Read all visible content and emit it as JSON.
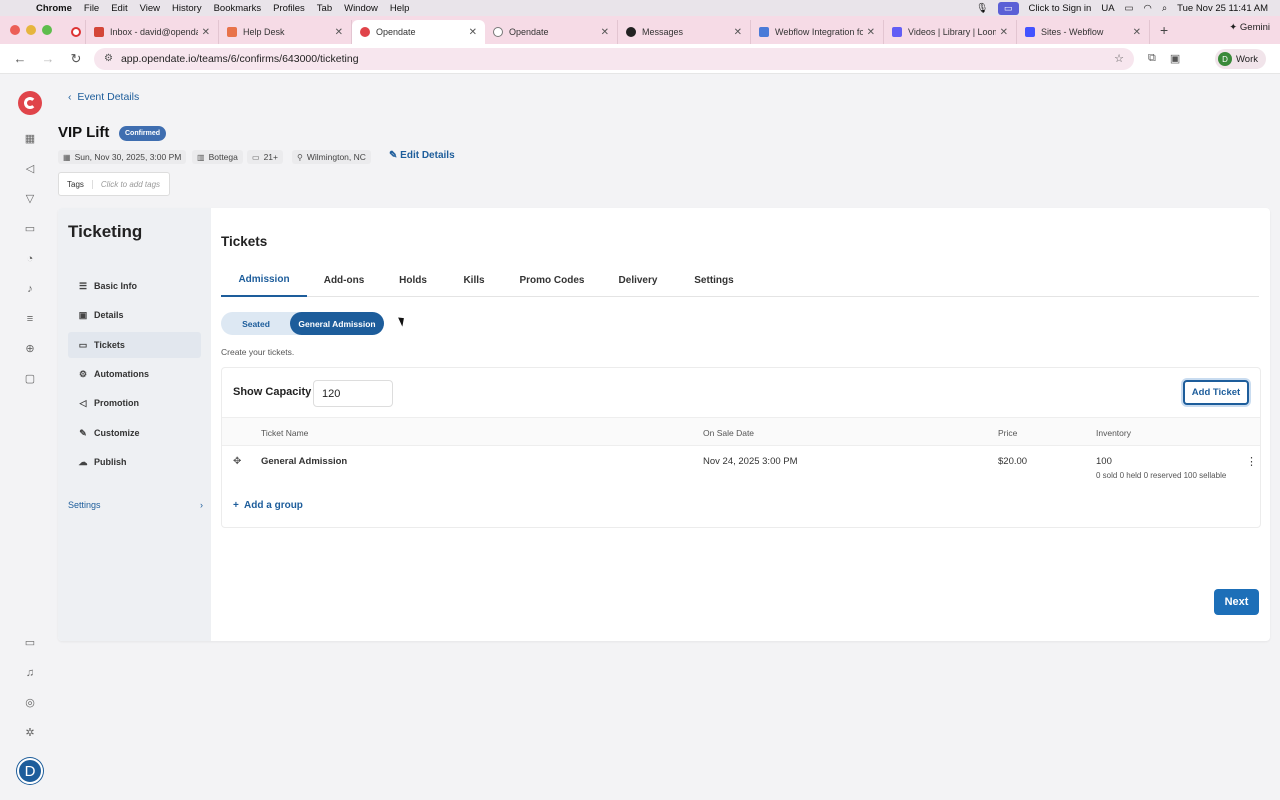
{
  "menubar": {
    "app": "Chrome",
    "items": [
      "File",
      "Edit",
      "View",
      "History",
      "Bookmarks",
      "Profiles",
      "Tab",
      "Window",
      "Help"
    ],
    "sign_in": "Click to Sign in",
    "ua": "UA",
    "datetime": "Tue Nov 25  11:41 AM"
  },
  "tabs": [
    {
      "title": "Inbox - david@opendate",
      "color": "#d44638"
    },
    {
      "title": "Help Desk",
      "color": "#e8734a"
    },
    {
      "title": "Opendate",
      "color": "#e0444a"
    },
    {
      "title": "Opendate",
      "color": "#777777"
    },
    {
      "title": "Messages",
      "color": "#222222"
    },
    {
      "title": "Webflow Integration fo",
      "color": "#4a7bd8"
    },
    {
      "title": "Videos | Library | Loom",
      "color": "#625df5"
    },
    {
      "title": "Sites - Webflow",
      "color": "#4353ff"
    }
  ],
  "gemini": "Gemini",
  "address": {
    "url": "app.opendate.io/teams/6/confirms/643000/ticketing",
    "profile": "Work",
    "profile_initial": "D"
  },
  "user": {
    "initial": "D"
  },
  "event": {
    "back_label": "Event Details",
    "title": "VIP Lift",
    "status": "Confirmed",
    "date": "Sun, Nov 30, 2025, 3:00 PM",
    "venue": "Bottega",
    "age": "21+",
    "location": "Wilmington, NC",
    "edit_label": "Edit Details",
    "tags_label": "Tags",
    "tags_placeholder": "Click to add tags"
  },
  "sidebar": {
    "title": "Ticketing",
    "items": [
      {
        "label": "Basic Info",
        "icon": "list-icon"
      },
      {
        "label": "Details",
        "icon": "image-icon"
      },
      {
        "label": "Tickets",
        "icon": "ticket-icon"
      },
      {
        "label": "Automations",
        "icon": "automation-icon"
      },
      {
        "label": "Promotion",
        "icon": "megaphone-icon"
      },
      {
        "label": "Customize",
        "icon": "brush-icon"
      },
      {
        "label": "Publish",
        "icon": "cloud-icon"
      }
    ],
    "settings_label": "Settings"
  },
  "main": {
    "title": "Tickets",
    "tabs": [
      "Admission",
      "Add-ons",
      "Holds",
      "Kills",
      "Promo Codes",
      "Delivery",
      "Settings"
    ],
    "segment": {
      "seated": "Seated",
      "general": "General Admission"
    },
    "hint": "Create your tickets.",
    "capacity_label": "Show Capacity",
    "capacity_value": "120",
    "add_ticket": "Add Ticket",
    "columns": [
      "Ticket Name",
      "On Sale Date",
      "Price",
      "Inventory"
    ],
    "rows": [
      {
        "name": "General Admission",
        "on_sale": "Nov 24, 2025 3:00 PM",
        "price": "$20.00",
        "inventory": "100",
        "inventory_detail": "0 sold 0 held 0 reserved 100 sellable"
      }
    ],
    "add_group": "Add a group",
    "next": "Next"
  },
  "colors": {
    "accent": "#1d5d9b",
    "brand": "#e0444a",
    "badge": "#3f6eb0"
  }
}
